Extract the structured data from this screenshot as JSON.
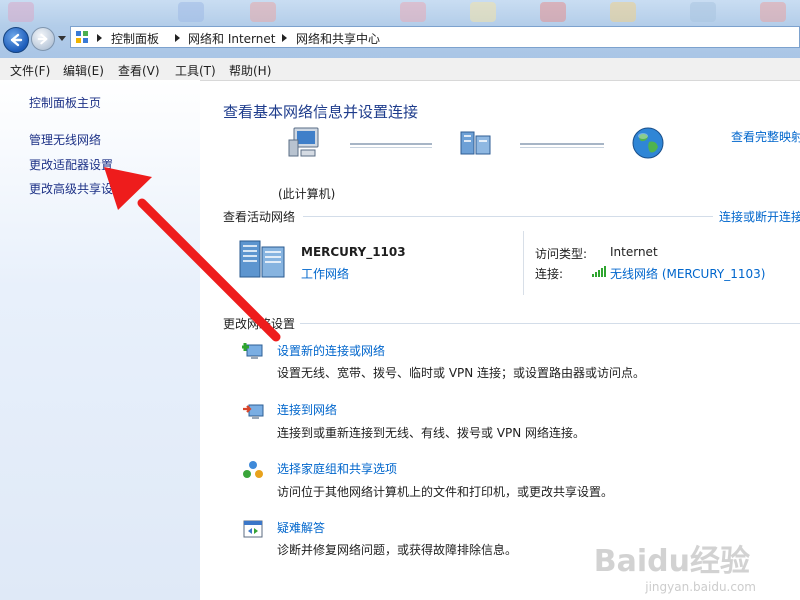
{
  "breadcrumb": [
    "控制面板",
    "网络和 Internet",
    "网络和共享中心"
  ],
  "menu": [
    "文件(F)",
    "编辑(E)",
    "查看(V)",
    "工具(T)",
    "帮助(H)"
  ],
  "sidebar": {
    "items": [
      {
        "label": "控制面板主页"
      },
      {
        "label": "管理无线网络"
      },
      {
        "label": "更改适配器设置"
      },
      {
        "label": "更改高级共享设置"
      }
    ]
  },
  "main": {
    "title": "查看基本网络信息并设置连接",
    "full_map": "查看完整映射",
    "this_computer": "(此计算机)",
    "active_networks_header": "查看活动网络",
    "connect_disconnect": "连接或断开连接",
    "network": {
      "name": "MERCURY_1103",
      "type": "工作网络",
      "access_type_label": "访问类型:",
      "access_type_value": "Internet",
      "connection_label": "连接:",
      "connection_value": "无线网络 (MERCURY_1103)"
    },
    "change_settings_header": "更改网络设置",
    "tasks": [
      {
        "title": "设置新的连接或网络",
        "desc": "设置无线、宽带、拨号、临时或 VPN 连接；或设置路由器或访问点。"
      },
      {
        "title": "连接到网络",
        "desc": "连接到或重新连接到无线、有线、拨号或 VPN 网络连接。"
      },
      {
        "title": "选择家庭组和共享选项",
        "desc": "访问位于其他网络计算机上的文件和打印机，或更改共享设置。"
      },
      {
        "title": "疑难解答",
        "desc": "诊断并修复网络问题，或获得故障排除信息。"
      }
    ]
  },
  "watermark": {
    "brand": "Baidu经验",
    "url": "jingyan.baidu.com"
  },
  "colors": {
    "link": "#0066cc",
    "title": "#1e3c8c",
    "annotation_arrow": "#ee1c1c"
  }
}
